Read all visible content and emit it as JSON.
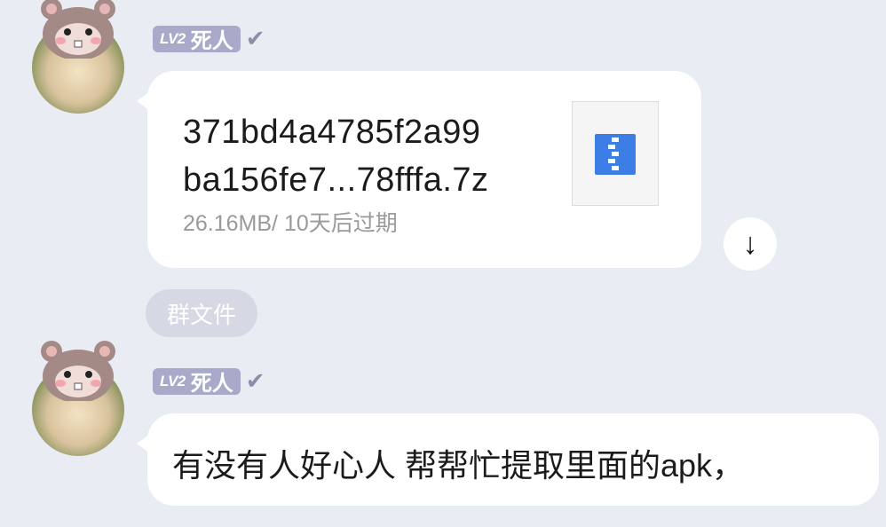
{
  "messages": [
    {
      "sender": {
        "level": "LV2",
        "name": "死人",
        "verified_icon": "check-icon"
      },
      "file": {
        "name_line1": "371bd4a4785f2a99",
        "name_line2": "ba156fe7...78fffa.7z",
        "meta": "26.16MB/ 10天后过期",
        "icon": "zip-file-icon"
      },
      "download_icon": "↓"
    },
    {
      "sender": {
        "level": "LV2",
        "name": "死人",
        "verified_icon": "check-icon"
      },
      "text": "有没有人好心人 帮帮忙提取里面的apk，"
    }
  ],
  "group_file_label": "群文件",
  "colors": {
    "background": "#eaecf4",
    "bubble": "#ffffff",
    "level_badge": "#a9aac9",
    "zip_icon": "#3d7ee6"
  }
}
